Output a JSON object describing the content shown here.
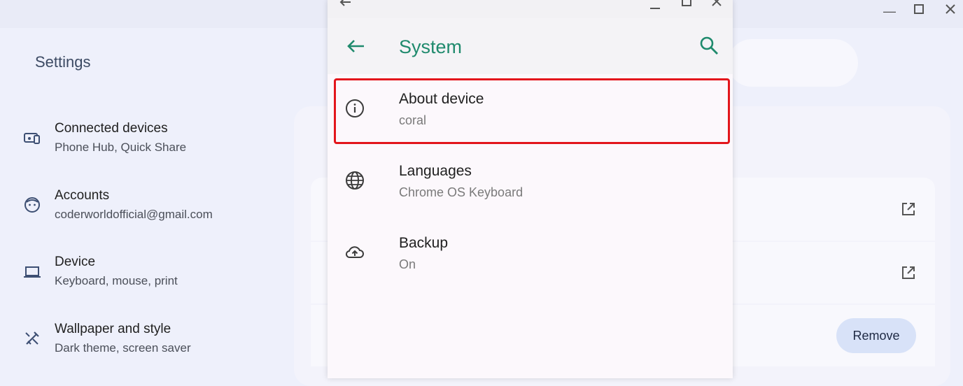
{
  "settings": {
    "title": "Settings",
    "nav": [
      {
        "title": "Connected devices",
        "subtitle": "Phone Hub, Quick Share",
        "icon": "connected-devices-icon"
      },
      {
        "title": "Accounts",
        "subtitle": "coderworldofficial@gmail.com",
        "icon": "account-icon"
      },
      {
        "title": "Device",
        "subtitle": "Keyboard, mouse, print",
        "icon": "laptop-icon"
      },
      {
        "title": "Wallpaper and style",
        "subtitle": "Dark theme, screen saver",
        "icon": "paintbrush-icon"
      }
    ],
    "remove_label": "Remove"
  },
  "dialog": {
    "title": "System",
    "items": [
      {
        "title": "About device",
        "subtitle": "coral",
        "icon": "info-icon"
      },
      {
        "title": "Languages",
        "subtitle": "Chrome OS Keyboard",
        "icon": "globe-icon"
      },
      {
        "title": "Backup",
        "subtitle": "On",
        "icon": "cloud-upload-icon"
      }
    ]
  },
  "colors": {
    "accent": "#1f8a6d",
    "highlight": "#e3161c",
    "background": "#eef0fb"
  }
}
